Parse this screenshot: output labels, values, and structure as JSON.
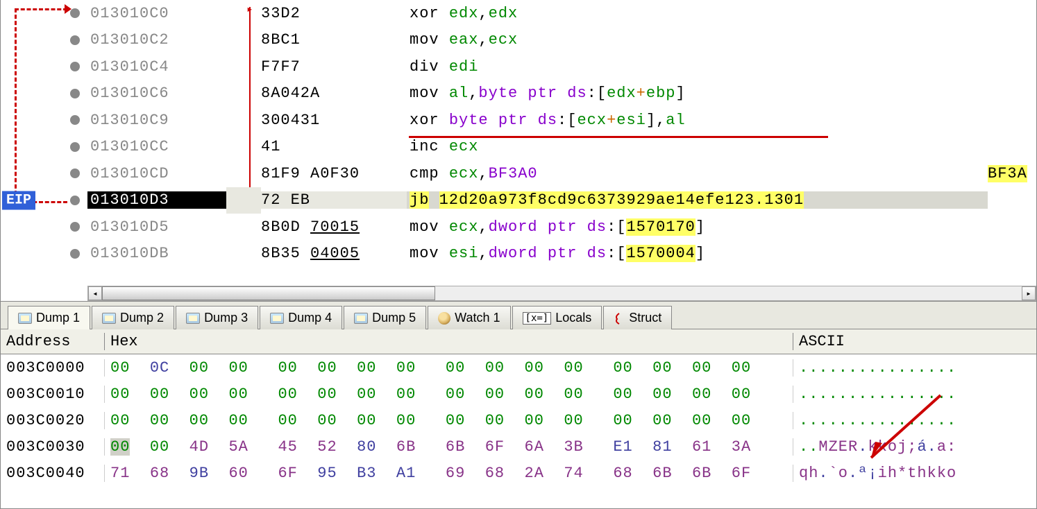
{
  "eip_label": "EIP",
  "disasm": {
    "rows": [
      {
        "addr": "013010C0",
        "bytes": "33D2",
        "instr_html": "<span class='mn'>xor</span> <span class='reg'>edx</span>,<span class='reg'>edx</span>",
        "current": false
      },
      {
        "addr": "013010C2",
        "bytes": "8BC1",
        "instr_html": "<span class='mn'>mov</span> <span class='reg'>eax</span>,<span class='reg'>ecx</span>",
        "current": false
      },
      {
        "addr": "013010C4",
        "bytes": "F7F7",
        "instr_html": "<span class='mn'>div</span> <span class='reg'>edi</span>",
        "current": false
      },
      {
        "addr": "013010C6",
        "bytes": "8A042A",
        "instr_html": "<span class='mn'>mov</span> <span class='reg'>al</span>,<span class='ds'>byte ptr</span> <span class='ds'>ds</span>:<span class='br'>[</span><span class='reg'>edx</span><span class='op-plus'>+</span><span class='reg'>ebp</span><span class='br'>]</span>",
        "current": false
      },
      {
        "addr": "013010C9",
        "bytes": "300431",
        "instr_html": "<span class='mn'>xor</span> <span class='ds'>byte ptr</span> <span class='ds'>ds</span>:<span class='br'>[</span><span class='reg'>ecx</span><span class='op-plus'>+</span><span class='reg'>esi</span><span class='br'>]</span>,<span class='reg'>al</span>",
        "current": false
      },
      {
        "addr": "013010CC",
        "bytes": "41",
        "instr_html": "<span class='mn'>inc</span> <span class='reg'>ecx</span>",
        "current": false
      },
      {
        "addr": "013010CD",
        "bytes": "81F9 A0F30",
        "instr_html": "<span class='mn'>cmp</span> <span class='reg'>ecx</span>,<span class='imm'>BF3A0</span>",
        "current": false,
        "comment": "BF3A"
      },
      {
        "addr": "013010D3",
        "bytes": "72 EB",
        "instr_html": "<span class='hl'>jb</span> <span class='hl'>12d20a973f8cd9c6373929ae14efe123.1301</span>",
        "current": true
      },
      {
        "addr": "013010D5",
        "bytes": "8B0D <span class='underline'>70015</span>",
        "instr_html": "<span class='mn'>mov</span> <span class='reg'>ecx</span>,<span class='ds'>dword ptr</span> <span class='ds'>ds</span>:<span class='br'>[</span><span class='hl'>1570170</span><span class='br'>]</span>",
        "current": false
      },
      {
        "addr": "013010DB",
        "bytes": "8B35 <span class='underline'>04005</span>",
        "instr_html": "<span class='mn'>mov</span> <span class='reg'>esi</span>,<span class='ds'>dword ptr</span> <span class='ds'>ds</span>:<span class='br'>[</span><span class='hl'>1570004</span><span class='br'>]</span>",
        "current": false
      }
    ]
  },
  "tabs": [
    {
      "label": "Dump 1",
      "icon": "dump",
      "active": true
    },
    {
      "label": "Dump 2",
      "icon": "dump",
      "active": false
    },
    {
      "label": "Dump 3",
      "icon": "dump",
      "active": false
    },
    {
      "label": "Dump 4",
      "icon": "dump",
      "active": false
    },
    {
      "label": "Dump 5",
      "icon": "dump",
      "active": false
    },
    {
      "label": "Watch 1",
      "icon": "watch",
      "active": false
    },
    {
      "label": "Locals",
      "icon": "locals",
      "active": false
    },
    {
      "label": "Struct",
      "icon": "struct",
      "active": false
    }
  ],
  "hex_header": {
    "addr": "Address",
    "hex": "Hex",
    "ascii": "ASCII"
  },
  "hex_rows": [
    {
      "addr": "003C0000",
      "bytes": [
        "00",
        "0C",
        "00",
        "00",
        "00",
        "00",
        "00",
        "00",
        "00",
        "00",
        "00",
        "00",
        "00",
        "00",
        "00",
        "00"
      ],
      "ascii_html": "<span class='dotc'>................</span>"
    },
    {
      "addr": "003C0010",
      "bytes": [
        "00",
        "00",
        "00",
        "00",
        "00",
        "00",
        "00",
        "00",
        "00",
        "00",
        "00",
        "00",
        "00",
        "00",
        "00",
        "00"
      ],
      "ascii_html": "<span class='dotc'>................</span>"
    },
    {
      "addr": "003C0020",
      "bytes": [
        "00",
        "00",
        "00",
        "00",
        "00",
        "00",
        "00",
        "00",
        "00",
        "00",
        "00",
        "00",
        "00",
        "00",
        "00",
        "00"
      ],
      "ascii_html": "<span class='dotc'>................</span>"
    },
    {
      "addr": "003C0030",
      "bytes": [
        "00",
        "00",
        "4D",
        "5A",
        "45",
        "52",
        "80",
        "6B",
        "6B",
        "6F",
        "6A",
        "3B",
        "E1",
        "81",
        "61",
        "3A"
      ],
      "ascii_html": "<span class='dotc'>..</span><span class='txtc'>MZER</span><span class='bluec'>.</span><span class='txtc'>kkoj;</span><span class='bluec'>á.</span><span class='txtc'>a:</span>",
      "hl_first": true
    },
    {
      "addr": "003C0040",
      "bytes": [
        "71",
        "68",
        "9B",
        "60",
        "6F",
        "95",
        "B3",
        "A1",
        "69",
        "68",
        "2A",
        "74",
        "68",
        "6B",
        "6B",
        "6F"
      ],
      "ascii_html": "<span class='txtc'>qh</span><span class='bluec'>.</span><span class='txtc'>`o</span><span class='bluec'>.ª¡</span><span class='txtc'>ih*thkko</span>"
    }
  ],
  "locals_icon_text": "[x=]"
}
